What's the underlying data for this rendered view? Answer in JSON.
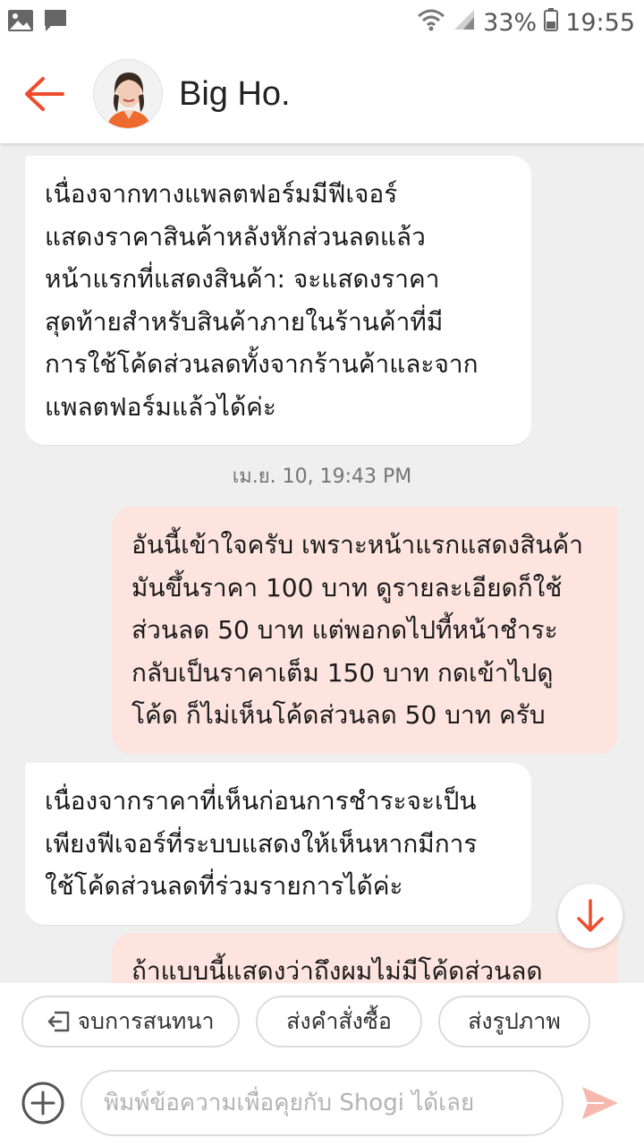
{
  "status_bar": {
    "battery": "33%",
    "time": "19:55"
  },
  "header": {
    "title": "Big Ho."
  },
  "messages": [
    {
      "direction": "in",
      "lines": [
        "เนื่องจากทางแพลตฟอร์มมีฟีเจอร์",
        "แสดงราคาสินค้าหลังหักส่วนลดแล้ว",
        "หน้าแรกที่แสดงสินค้า: จะแสดงราคา",
        "สุดท้ายสำหรับสินค้าภายในร้านค้าที่มี",
        "การใช้โค้ดส่วนลดทั้งจากร้านค้าและจาก",
        "แพลตฟอร์มแล้วได้ค่ะ"
      ]
    },
    {
      "direction": "out",
      "lines": [
        "อันนี้เข้าใจครับ เพราะหน้าแรกแสดงสินค้า",
        "มันขึ้นราคา 100 บาท ดูรายละเอียดก็ใช้",
        "ส่วนลด 50 บาท แต่พอกดไปที้หน้าชำระ",
        "กลับเป็นราคาเต็ม 150 บาท กดเข้าไปดู",
        "โค้ด ก็ไม่เห็นโค้ดส่วนลด 50 บาท ครับ"
      ]
    },
    {
      "direction": "in",
      "lines": [
        "เนื่องจากราคาที่เห็นก่อนการชำระจะเป็น",
        "เพียงฟีเจอร์ที่ระบบแสดงให้เห็นหากมีการ",
        "ใช้โค้ดส่วนลดที่ร่วมรายการได้ค่ะ"
      ]
    },
    {
      "direction": "out",
      "lines": [
        "ถ้าแบบนี้แสดงว่าถึงผมไม่มีโค้ดส่วนลด"
      ]
    }
  ],
  "timestamp": "เม.ย. 10, 19:43 PM",
  "quick_actions": {
    "end_chat": "จบการสนทนา",
    "send_order": "ส่งคำสั่งซื้อ",
    "send_photo": "ส่งรูปภาพ"
  },
  "composer": {
    "placeholder": "พิมพ์ข้อความเพื่อคุยกับ Shogi ได้เลย"
  },
  "colors": {
    "accent": "#ee4d2d",
    "outgoing_bubble": "#fde4df",
    "incoming_bubble": "#ffffff",
    "background": "#efefef",
    "send_disabled": "#f7b9ad"
  }
}
